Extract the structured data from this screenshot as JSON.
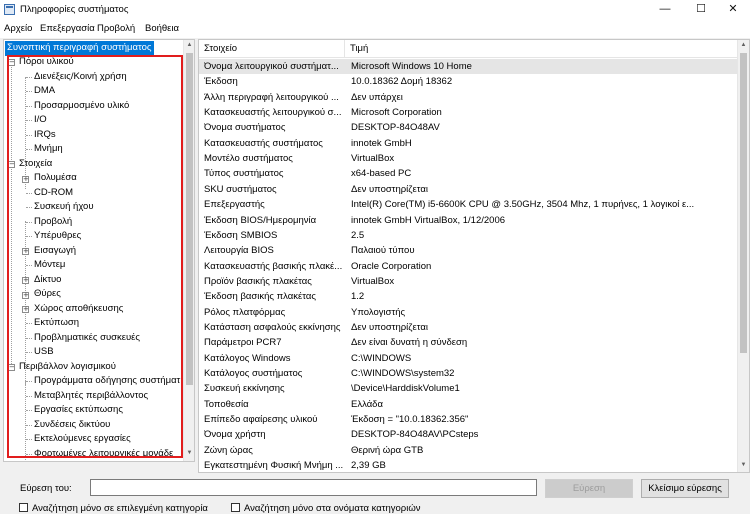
{
  "window": {
    "title": "Πληροφορίες συστήματος",
    "controls": {
      "minimize": "—",
      "maximize": "☐",
      "close": "✕"
    }
  },
  "menu": [
    "Αρχείο",
    "Επεξεργασία",
    "Προβολή",
    "Βοήθεια"
  ],
  "tree": {
    "root": "Συνοπτική περιγραφή συστήματος",
    "hardware": {
      "label": "Πόροι υλικού",
      "children": [
        "Διενέξεις/Κοινή χρήση",
        "DMA",
        "Προσαρμοσμένο υλικό",
        "I/O",
        "IRQs",
        "Μνήμη"
      ]
    },
    "components": {
      "label": "Στοιχεία",
      "children": [
        "Πολυμέσα",
        "CD-ROM",
        "Συσκευή ήχου",
        "Προβολή",
        "Υπέρυθρες",
        "Εισαγωγή",
        "Μόντεμ",
        "Δίκτυο",
        "Θύρες",
        "Χώρος αποθήκευσης",
        "Εκτύπωση",
        "Προβληματικές συσκευές",
        "USB"
      ]
    },
    "software": {
      "label": "Περιβάλλον λογισμικού",
      "children": [
        "Προγράμματα οδήγησης συστήματ",
        "Μεταβλητές περιβάλλοντος",
        "Εργασίες εκτύπωσης",
        "Συνδέσεις δικτύου",
        "Εκτελούμενες εργασίες",
        "Φορτωμένες λειτουργικές μονάδε"
      ]
    }
  },
  "table": {
    "headers": [
      "Στοιχείο",
      "Τιμή"
    ],
    "rows": [
      [
        "Όνομα λειτουργικού συστήματ...",
        "Microsoft Windows 10 Home"
      ],
      [
        "Έκδοση",
        "10.0.18362 Δομή 18362"
      ],
      [
        "Άλλη περιγραφή λειτουργικού ...",
        "Δεν υπάρχει"
      ],
      [
        "Κατασκευαστής λειτουργικού σ...",
        "Microsoft Corporation"
      ],
      [
        "Όνομα συστήματος",
        "DESKTOP-84O48AV"
      ],
      [
        "Κατασκευαστής συστήματος",
        "innotek GmbH"
      ],
      [
        "Μοντέλο συστήματος",
        "VirtualBox"
      ],
      [
        "Τύπος συστήματος",
        "x64-based PC"
      ],
      [
        "SKU συστήματος",
        "Δεν υποστηρίζεται"
      ],
      [
        "Επεξεργαστής",
        "Intel(R) Core(TM) i5-6600K CPU @ 3.50GHz, 3504 Mhz, 1 πυρήνες, 1 λογικοί ε..."
      ],
      [
        "Έκδοση BIOS/Ημερομηνία",
        "innotek GmbH VirtualBox, 1/12/2006"
      ],
      [
        "Έκδοση SMBIOS",
        "2.5"
      ],
      [
        "Λειτουργία BIOS",
        "Παλαιού τύπου"
      ],
      [
        "Κατασκευαστής βασικής πλακέ...",
        "Oracle Corporation"
      ],
      [
        "Προϊόν βασικής πλακέτας",
        "VirtualBox"
      ],
      [
        "Έκδοση βασικής πλακέτας",
        "1.2"
      ],
      [
        "Ρόλος πλατφόρμας",
        "Υπολογιστής"
      ],
      [
        "Κατάσταση ασφαλούς εκκίνησης",
        "Δεν υποστηρίζεται"
      ],
      [
        "Παράμετροι PCR7",
        "Δεν είναι δυνατή η σύνδεση"
      ],
      [
        "Κατάλογος Windows",
        "C:\\WINDOWS"
      ],
      [
        "Κατάλογος συστήματος",
        "C:\\WINDOWS\\system32"
      ],
      [
        "Συσκευή εκκίνησης",
        "\\Device\\HarddiskVolume1"
      ],
      [
        "Τοποθεσία",
        "Ελλάδα"
      ],
      [
        "Επίπεδο αφαίρεσης υλικού",
        "Έκδοση = \"10.0.18362.356\""
      ],
      [
        "Όνομα χρήστη",
        "DESKTOP-84O48AV\\PCsteps"
      ],
      [
        "Ζώνη ώρας",
        "Θερινή ώρα GTB"
      ],
      [
        "Εγκατεστημένη Φυσική Μνήμη ...",
        "2,39 GB"
      ]
    ]
  },
  "find": {
    "label": "Εύρεση του:",
    "value": "",
    "find_button": "Εύρεση",
    "close_button": "Κλείσιμο εύρεσης",
    "option_selected_category": "Αναζήτηση μόνο σε επιλεγμένη κατηγορία",
    "option_category_names": "Αναζήτηση μόνο στα ονόματα κατηγοριών"
  },
  "colors": {
    "selection": "#0078d7",
    "highlight_box": "#e11d1d"
  }
}
